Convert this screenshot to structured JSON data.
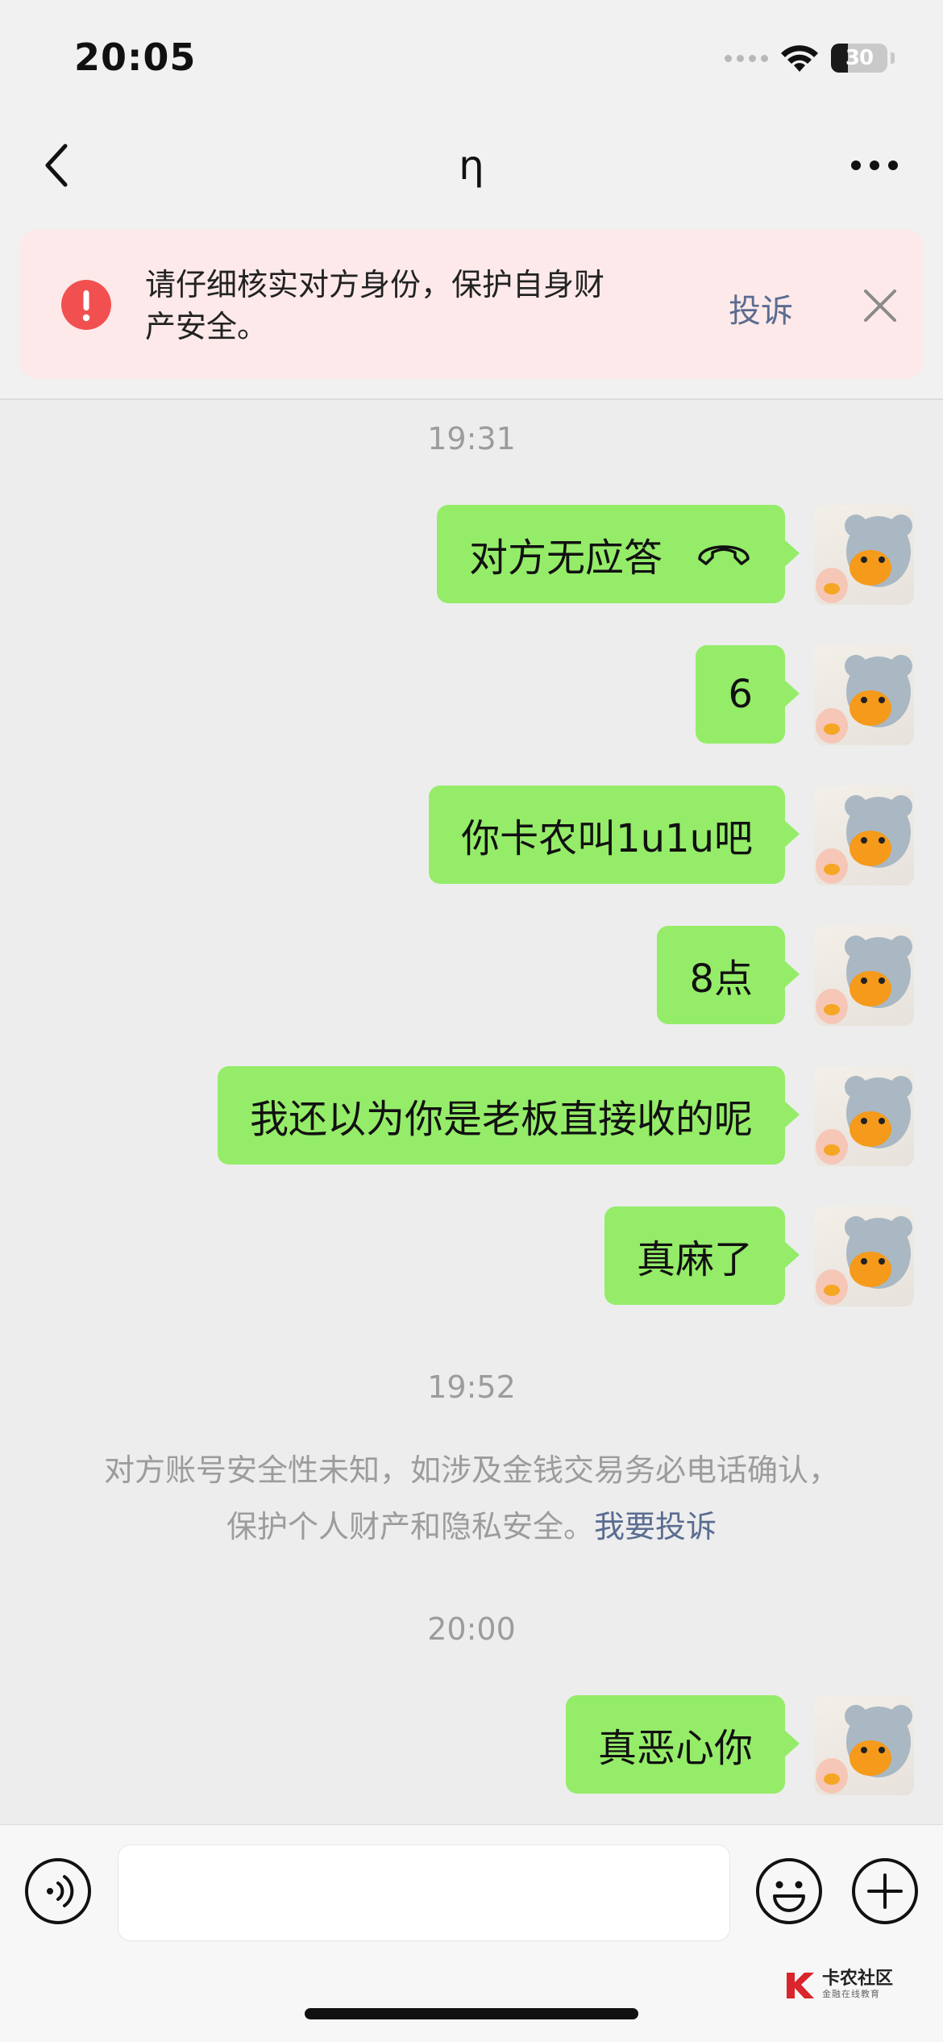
{
  "status_bar": {
    "time": "20:05",
    "battery": 30,
    "battery_label": "30",
    "icons": [
      "signal-dots-icon",
      "wifi-icon",
      "battery-icon"
    ]
  },
  "header": {
    "title": "η",
    "back_icon": "chevron-left-icon",
    "more_icon": "more-dots-icon"
  },
  "warning_banner": {
    "text": "请仔细核实对方身份，保护自身财产安全。",
    "report_label": "投诉",
    "icon": "exclamation-icon",
    "close_icon": "close-icon",
    "background": "#fde9e9",
    "icon_color": "#f25050"
  },
  "chat": {
    "bubble_color": "#95ec69",
    "timestamps": [
      "19:31",
      "19:52",
      "20:00"
    ],
    "messages": [
      {
        "text": "对方无应答",
        "icon": "hang-up-phone-icon"
      },
      {
        "text": "6"
      },
      {
        "text": "你卡农叫1u1u吧"
      },
      {
        "text": "8点"
      },
      {
        "text": "我还以为你是老板直接收的呢"
      },
      {
        "text": "真麻了"
      },
      {
        "text": "真恶心你"
      }
    ],
    "system_notice": {
      "line1": "对方账号安全性未知，如涉及金钱交易务必电话确认，",
      "line2": "保护个人财产和隐私安全。",
      "link": "我要投诉"
    }
  },
  "input_bar": {
    "voice_icon": "voice-icon",
    "emoji_icon": "emoji-icon",
    "plus_icon": "plus-icon",
    "input_value": ""
  },
  "watermark": {
    "title": "卡农社区",
    "subtitle": "金融在线教育"
  }
}
